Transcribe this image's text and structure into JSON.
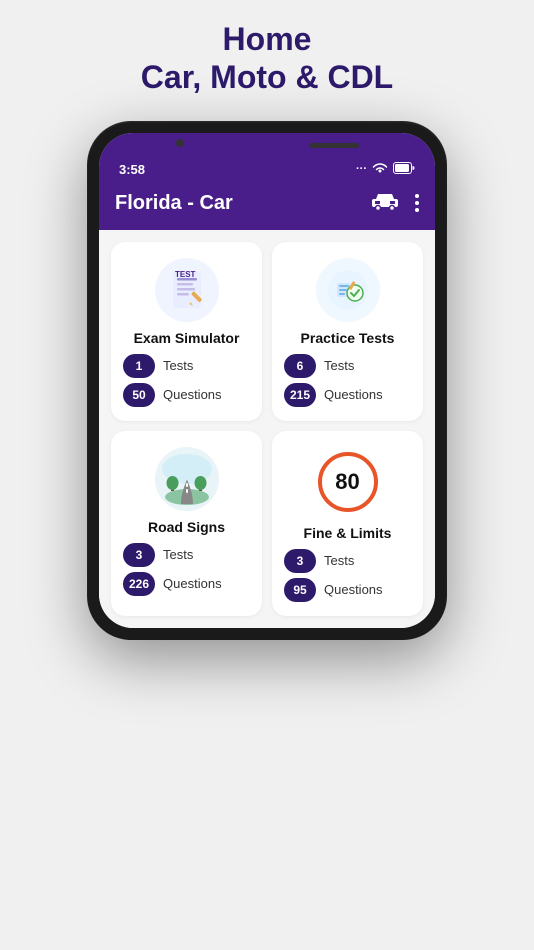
{
  "header": {
    "title": "Home",
    "subtitle": "Car, Moto & CDL"
  },
  "statusBar": {
    "time": "3:58",
    "icons": [
      "...",
      "wifi",
      "battery"
    ]
  },
  "appBar": {
    "title": "Florida - Car"
  },
  "cards": [
    {
      "id": "exam-simulator",
      "title": "Exam Simulator",
      "stats": [
        {
          "value": "1",
          "label": "Tests"
        },
        {
          "value": "50",
          "label": "Questions"
        }
      ]
    },
    {
      "id": "practice-tests",
      "title": "Practice Tests",
      "stats": [
        {
          "value": "6",
          "label": "Tests"
        },
        {
          "value": "215",
          "label": "Questions"
        }
      ]
    },
    {
      "id": "road-signs",
      "title": "Road Signs",
      "stats": [
        {
          "value": "3",
          "label": "Tests"
        },
        {
          "value": "226",
          "label": "Questions"
        }
      ]
    },
    {
      "id": "fine-limits",
      "title": "Fine & Limits",
      "stats": [
        {
          "value": "3",
          "label": "Tests"
        },
        {
          "value": "95",
          "label": "Questions"
        }
      ]
    }
  ]
}
